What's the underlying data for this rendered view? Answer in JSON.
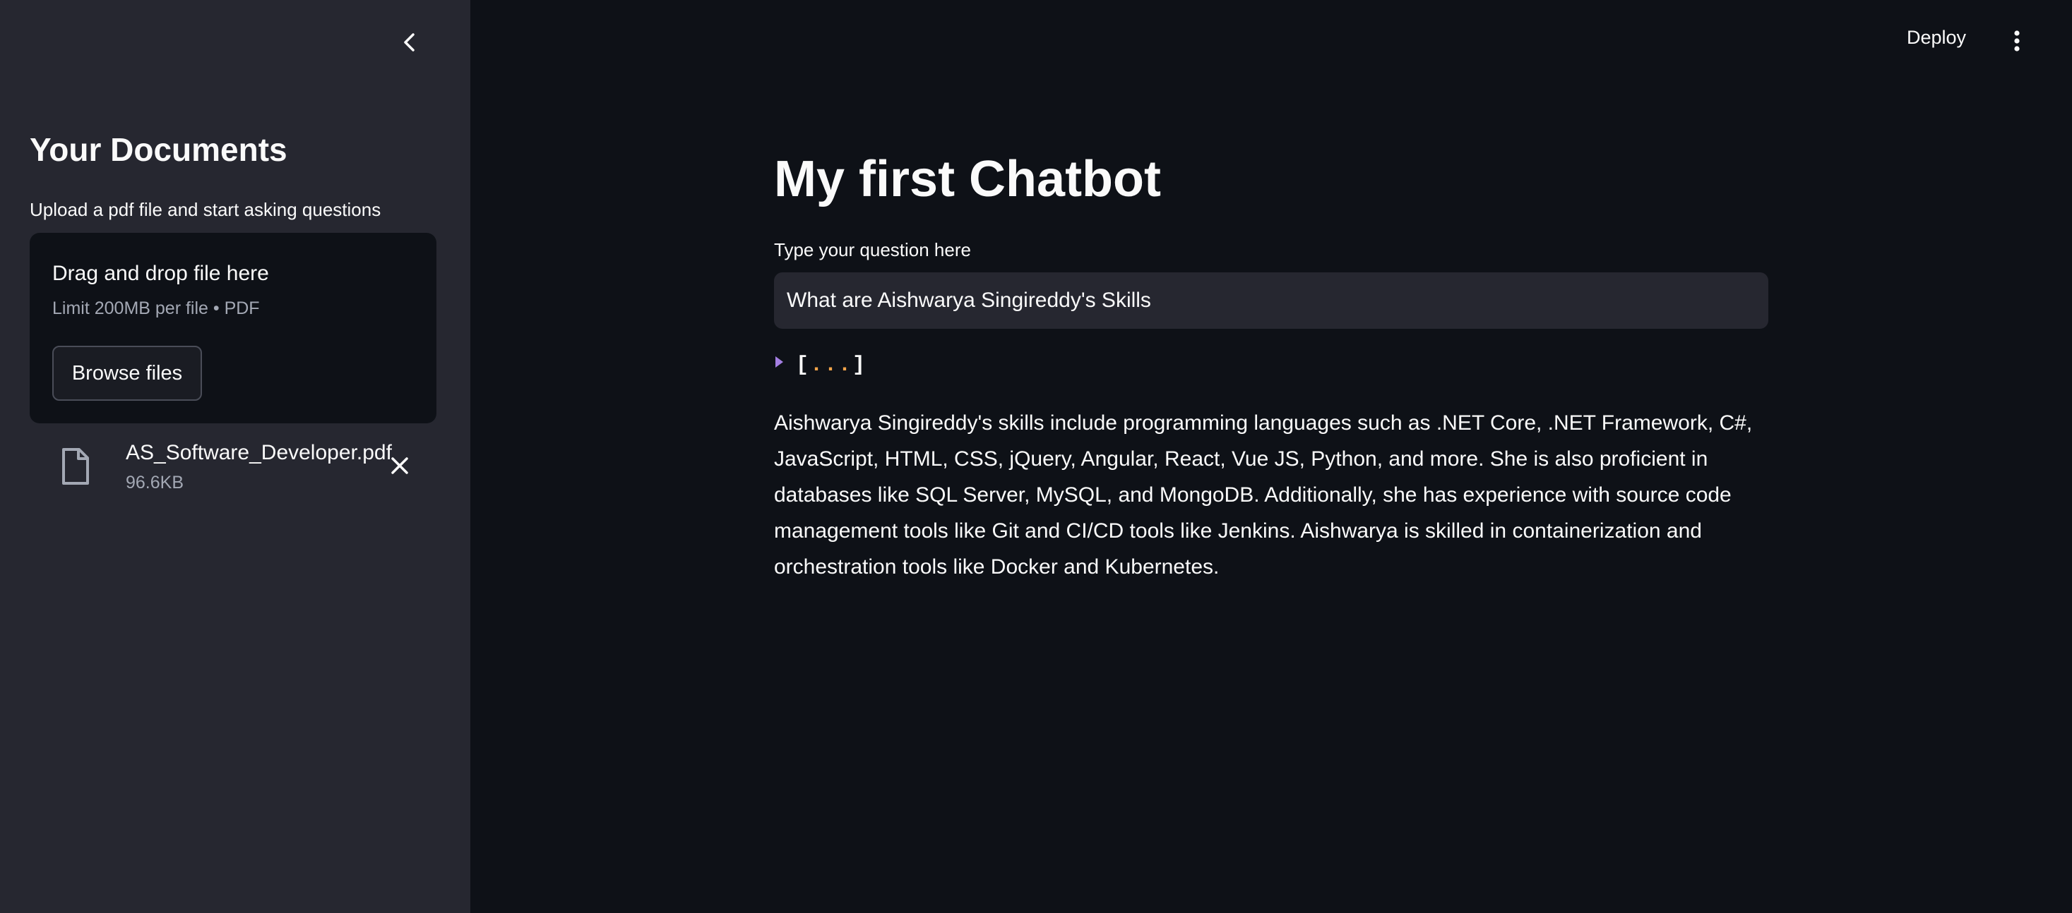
{
  "sidebar": {
    "collapse_icon": "chevron-left-icon",
    "title": "Your Documents",
    "subtitle": "Upload a pdf file and start asking questions",
    "uploader": {
      "dropzone_title": "Drag and drop file here",
      "limit_text": "Limit 200MB per file • PDF",
      "browse_label": "Browse files"
    },
    "uploaded_file": {
      "icon": "file-icon",
      "name": "AS_Software_Developer.pdf",
      "size": "96.6KB",
      "remove_icon": "close-icon"
    }
  },
  "header": {
    "deploy_label": "Deploy",
    "menu_icon": "more-vertical-icon"
  },
  "main": {
    "title": "My first Chatbot",
    "input_label": "Type your question here",
    "input_value": "What are Aishwarya Singireddy's Skills",
    "json_toggle": {
      "open": "[",
      "dots": "...",
      "close": "]"
    },
    "answer": "Aishwarya Singireddy's skills include programming languages such as .NET Core, .NET Framework, C#, JavaScript, HTML, CSS, jQuery, Angular, React, Vue JS, Python, and more. She is also proficient in databases like SQL Server, MySQL, and MongoDB. Additionally, she has experience with source code management tools like Git and CI/CD tools like Jenkins. Aishwarya is skilled in containerization and orchestration tools like Docker and Kubernetes."
  },
  "colors": {
    "background": "#0e1117",
    "sidebar": "#262730",
    "input": "#262730",
    "text": "#fafafa",
    "muted": "#a3a8b4",
    "accent": "#a47fe3",
    "json_dots": "#f5a54a"
  }
}
